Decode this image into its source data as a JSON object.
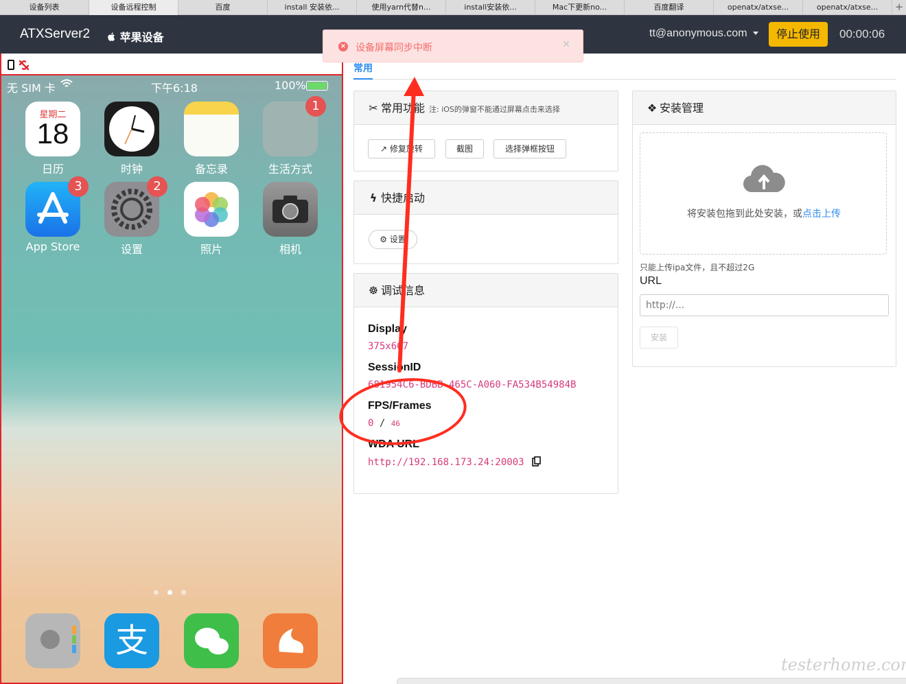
{
  "browser_tabs": [
    {
      "label": "设备列表",
      "active": false
    },
    {
      "label": "设备远程控制",
      "active": true
    },
    {
      "label": "百度",
      "active": false
    },
    {
      "label": "install 安装依...",
      "active": false
    },
    {
      "label": "使用yarn代替n...",
      "active": false
    },
    {
      "label": "install安装依...",
      "active": false
    },
    {
      "label": "Mac下更新no...",
      "active": false
    },
    {
      "label": "百度翻译",
      "active": false
    },
    {
      "label": "openatx/atxse...",
      "active": false
    },
    {
      "label": "openatx/atxse...",
      "active": false
    }
  ],
  "new_tab_label": "+",
  "navbar": {
    "brand": "ATXServer2",
    "device_type": "苹果设备",
    "user": "tt@anonymous.com",
    "stop_label": "停止使用",
    "timer": "00:00:06"
  },
  "phone": {
    "carrier": "无 SIM 卡",
    "time": "下午6:18",
    "battery": "100%",
    "calendar_weekday": "星期二",
    "calendar_day": "18",
    "apps": [
      {
        "label": "日历",
        "icon": "calendar-icon",
        "color": "#ffffff",
        "badge": ""
      },
      {
        "label": "时钟",
        "icon": "clock-icon",
        "color": "#1c1c1c",
        "badge": ""
      },
      {
        "label": "备忘录",
        "icon": "notes-icon",
        "color": "#f7d44c",
        "badge": ""
      },
      {
        "label": "生活方式",
        "icon": "folder-icon",
        "color": "#9fb4b0",
        "badge": "1"
      },
      {
        "label": "App Store",
        "icon": "app-store-icon",
        "color": "#1a8ef2",
        "badge": "3"
      },
      {
        "label": "设置",
        "icon": "settings-icon",
        "color": "#8e8e93",
        "badge": "2"
      },
      {
        "label": "照片",
        "icon": "photos-icon",
        "color": "#ffffff",
        "badge": ""
      },
      {
        "label": "相机",
        "icon": "camera-icon",
        "color": "#6b6b6b",
        "badge": ""
      }
    ],
    "dock": [
      {
        "icon": "contacts-icon",
        "color": "#b7b7b7"
      },
      {
        "icon": "alipay-icon",
        "color": "#1a9ae0",
        "glyph": "支"
      },
      {
        "icon": "wechat-icon",
        "color": "#3fbf4a"
      },
      {
        "icon": "uc-browser-icon",
        "color": "#f07d3c"
      }
    ]
  },
  "toast": {
    "message": "设备屏幕同步中断"
  },
  "tabs": {
    "common": "常用"
  },
  "panels": {
    "common_features": {
      "title": "常用功能",
      "note": "注: iOS的弹窗不能通过屏幕点击来选择",
      "buttons": {
        "fix_rotate": "修复旋转",
        "screenshot": "截图",
        "select_alert": "选择弹框按钮"
      }
    },
    "quick_launch": {
      "title": "快捷启动",
      "settings_label": "设置"
    },
    "debug": {
      "title": "调试信息",
      "display_label": "Display",
      "display_value": "375x667",
      "session_label": "SessionID",
      "session_value": "681954C6-BDBB-465C-A060-FA534B54984B",
      "fps_label": "FPS/Frames",
      "fps_value": "0",
      "frames_value": "46",
      "wda_label": "WDA URL",
      "wda_value": "http://192.168.173.24:20003"
    },
    "install": {
      "title": "安装管理",
      "drop_text": "将安装包拖到此处安装，或",
      "upload_link": "点击上传",
      "hint": "只能上传ipa文件，且不超过2G",
      "url_label": "URL",
      "url_placeholder": "http://...",
      "install_button": "安装"
    }
  },
  "watermark": "testerhome.com",
  "annotation_color": "#ff2d20"
}
